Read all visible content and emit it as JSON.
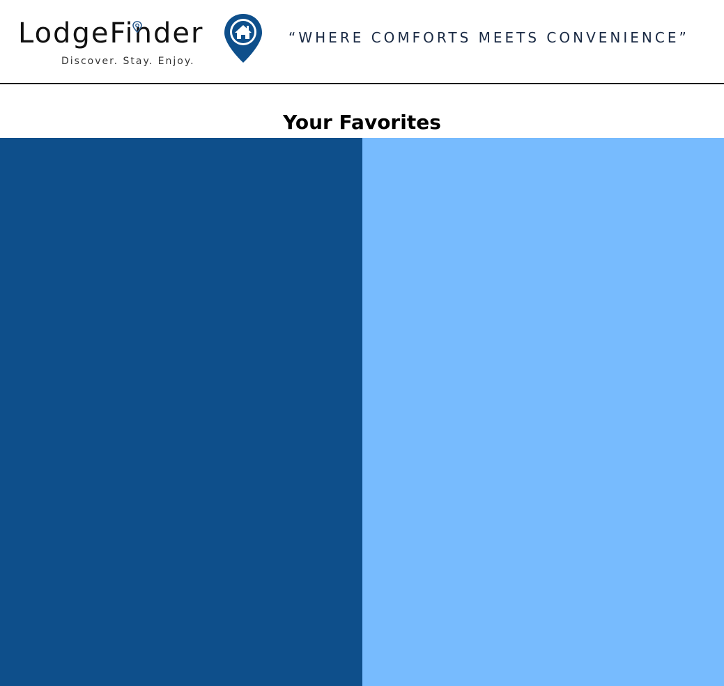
{
  "brand": {
    "name": "LodgeFinder",
    "tagline": "Discover. Stay. Enjoy.",
    "pin_color": "#0e4f8b"
  },
  "header": {
    "slogan": "“WHERE COMFORTS MEETS CONVENIENCE”"
  },
  "main": {
    "section_title": "Your Favorites"
  },
  "panels": {
    "left_color": "#0e4f8b",
    "right_color": "#77bbfe"
  }
}
